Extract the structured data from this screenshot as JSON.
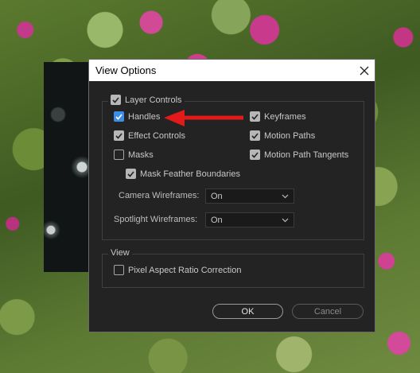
{
  "dialog": {
    "title": "View Options",
    "close_glyph": "✕",
    "layer_controls": {
      "legend": "Layer Controls",
      "checked": true,
      "handles": {
        "label": "Handles",
        "checked": true
      },
      "effect_controls": {
        "label": "Effect Controls",
        "checked": true
      },
      "masks": {
        "label": "Masks",
        "checked": false
      },
      "mask_feather": {
        "label": "Mask Feather Boundaries",
        "checked": true
      },
      "keyframes": {
        "label": "Keyframes",
        "checked": true
      },
      "motion_paths": {
        "label": "Motion Paths",
        "checked": true
      },
      "motion_path_tangents": {
        "label": "Motion Path Tangents",
        "checked": true
      },
      "camera_wireframes": {
        "label": "Camera Wireframes:",
        "value": "On"
      },
      "spotlight_wireframes": {
        "label": "Spotlight Wireframes:",
        "value": "On"
      }
    },
    "view": {
      "legend": "View",
      "pixel_aspect": {
        "label": "Pixel Aspect Ratio Correction",
        "checked": false
      }
    },
    "buttons": {
      "ok": "OK",
      "cancel": "Cancel"
    }
  },
  "icons": {
    "close": "close-icon",
    "checkmark": "checkmark-icon",
    "chevron": "chevron-down-icon",
    "arrow": "red-arrow-annotation"
  },
  "colors": {
    "dialog_bg": "#232323",
    "check_blue": "#3d8ee6",
    "annotation_red": "#e21a1a"
  }
}
